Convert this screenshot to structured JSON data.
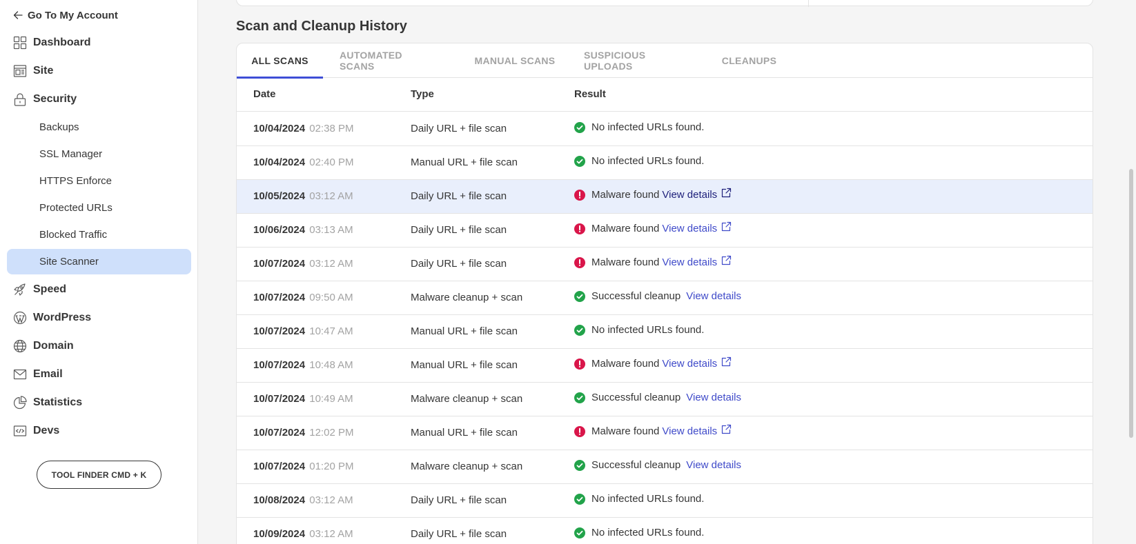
{
  "sidebar": {
    "back_label": "Go To My Account",
    "nav": [
      {
        "label": "Dashboard",
        "icon": "dashboard-icon"
      },
      {
        "label": "Site",
        "icon": "site-icon"
      },
      {
        "label": "Security",
        "icon": "lock-icon"
      },
      {
        "label": "Speed",
        "icon": "rocket-icon"
      },
      {
        "label": "WordPress",
        "icon": "wordpress-icon"
      },
      {
        "label": "Domain",
        "icon": "globe-icon"
      },
      {
        "label": "Email",
        "icon": "mail-icon"
      },
      {
        "label": "Statistics",
        "icon": "pie-chart-icon"
      },
      {
        "label": "Devs",
        "icon": "code-icon"
      }
    ],
    "security_items": [
      "Backups",
      "SSL Manager",
      "HTTPS Enforce",
      "Protected URLs",
      "Blocked Traffic",
      "Site Scanner"
    ],
    "active_item": "Site Scanner",
    "tool_finder_label": "TOOL FINDER CMD + K"
  },
  "main": {
    "section_title": "Scan and Cleanup History",
    "tabs": [
      "ALL SCANS",
      "AUTOMATED SCANS",
      "MANUAL SCANS",
      "SUSPICIOUS UPLOADS",
      "CLEANUPS"
    ],
    "active_tab": "ALL SCANS",
    "columns": [
      "Date",
      "Type",
      "Result"
    ],
    "view_details_label": "View details",
    "rows": [
      {
        "date": "10/04/2024",
        "time": "02:38 PM",
        "type": "Daily URL + file scan",
        "status": "ok",
        "result": "No infected URLs found."
      },
      {
        "date": "10/04/2024",
        "time": "02:40 PM",
        "type": "Manual URL + file scan",
        "status": "ok",
        "result": "No infected URLs found."
      },
      {
        "date": "10/05/2024",
        "time": "03:12 AM",
        "type": "Daily URL + file scan",
        "status": "malware",
        "result": "Malware found"
      },
      {
        "date": "10/06/2024",
        "time": "03:13 AM",
        "type": "Daily URL + file scan",
        "status": "malware",
        "result": "Malware found"
      },
      {
        "date": "10/07/2024",
        "time": "03:12 AM",
        "type": "Daily URL + file scan",
        "status": "malware",
        "result": "Malware found"
      },
      {
        "date": "10/07/2024",
        "time": "09:50 AM",
        "type": "Malware cleanup + scan",
        "status": "cleanup",
        "result": "Successful cleanup"
      },
      {
        "date": "10/07/2024",
        "time": "10:47 AM",
        "type": "Manual URL + file scan",
        "status": "ok",
        "result": "No infected URLs found."
      },
      {
        "date": "10/07/2024",
        "time": "10:48 AM",
        "type": "Manual URL + file scan",
        "status": "malware",
        "result": "Malware found"
      },
      {
        "date": "10/07/2024",
        "time": "10:49 AM",
        "type": "Malware cleanup + scan",
        "status": "cleanup",
        "result": "Successful cleanup"
      },
      {
        "date": "10/07/2024",
        "time": "12:02 PM",
        "type": "Manual URL + file scan",
        "status": "malware",
        "result": "Malware found"
      },
      {
        "date": "10/07/2024",
        "time": "01:20 PM",
        "type": "Malware cleanup + scan",
        "status": "cleanup",
        "result": "Successful cleanup"
      },
      {
        "date": "10/08/2024",
        "time": "03:12 AM",
        "type": "Daily URL + file scan",
        "status": "ok",
        "result": "No infected URLs found."
      },
      {
        "date": "10/09/2024",
        "time": "03:12 AM",
        "type": "Daily URL + file scan",
        "status": "ok",
        "result": "No infected URLs found."
      }
    ],
    "highlighted_row": 2
  },
  "colors": {
    "accent": "#3e4ed6",
    "link": "#3f4ac9",
    "success": "#22a34a",
    "danger": "#d9164a",
    "active_bg": "#cfe0fb",
    "highlight_row": "#e9effc"
  }
}
